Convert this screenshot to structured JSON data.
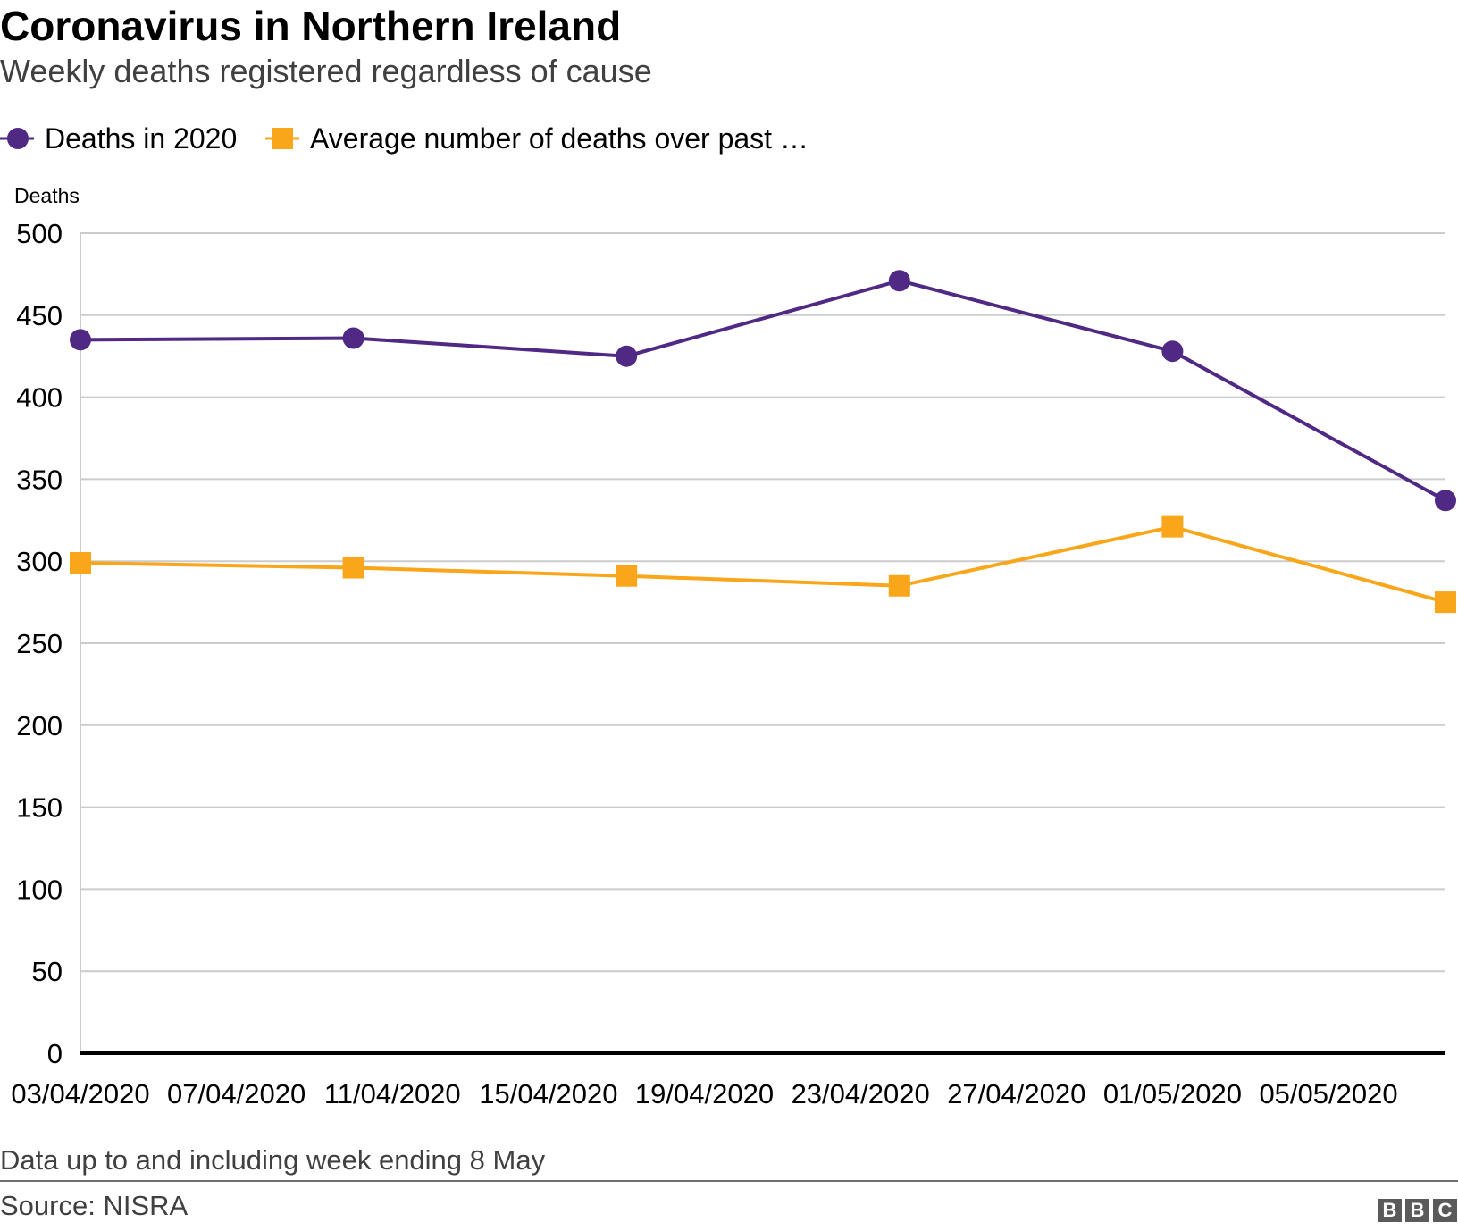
{
  "header": {
    "title": "Coronavirus in Northern Ireland",
    "subtitle": "Weekly deaths registered regardless of cause"
  },
  "footer": {
    "note": "Data up to and including week ending 8 May",
    "source": "Source: NISRA",
    "logo_letters": [
      "B",
      "B",
      "C"
    ]
  },
  "colors": {
    "deaths_2020": "#4f2984",
    "average": "#f9a61b",
    "gridline": "#cccccc",
    "baseline": "#000000"
  },
  "chart_data": {
    "type": "line",
    "title": "Coronavirus in Northern Ireland",
    "subtitle": "Weekly deaths registered regardless of cause",
    "xlabel": "",
    "ylabel": "Deaths",
    "ylim": [
      0,
      500
    ],
    "yticks": [
      0,
      50,
      100,
      150,
      200,
      250,
      300,
      350,
      400,
      450,
      500
    ],
    "xlim": [
      "03/04/2020",
      "08/05/2020"
    ],
    "xticks": [
      "03/04/2020",
      "07/04/2020",
      "11/04/2020",
      "15/04/2020",
      "19/04/2020",
      "23/04/2020",
      "27/04/2020",
      "01/05/2020",
      "05/05/2020"
    ],
    "x": [
      "03/04/2020",
      "10/04/2020",
      "17/04/2020",
      "24/04/2020",
      "01/05/2020",
      "08/05/2020"
    ],
    "grid": true,
    "legend_position": "top-left",
    "series": [
      {
        "name": "Deaths in 2020",
        "marker": "circle",
        "color": "#4f2984",
        "values": [
          435,
          436,
          425,
          471,
          428,
          337
        ]
      },
      {
        "name": "Average number of deaths over past …",
        "marker": "square",
        "color": "#f9a61b",
        "values": [
          299,
          296,
          291,
          285,
          321,
          275
        ]
      }
    ]
  }
}
